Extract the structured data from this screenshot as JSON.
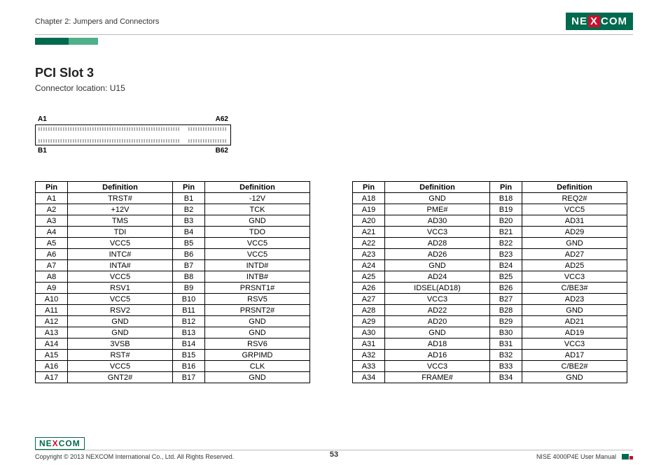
{
  "header": {
    "chapter": "Chapter 2: Jumpers and Connectors",
    "logo_ne": "NE",
    "logo_x": "X",
    "logo_com": "COM"
  },
  "title": "PCI Slot 3",
  "subtitle": "Connector location: U15",
  "conn": {
    "a1": "A1",
    "a62": "A62",
    "b1": "B1",
    "b62": "B62"
  },
  "th": {
    "pin": "Pin",
    "def": "Definition"
  },
  "table1": [
    {
      "ap": "A1",
      "ad": "TRST#",
      "bp": "B1",
      "bd": "-12V"
    },
    {
      "ap": "A2",
      "ad": "+12V",
      "bp": "B2",
      "bd": "TCK"
    },
    {
      "ap": "A3",
      "ad": "TMS",
      "bp": "B3",
      "bd": "GND"
    },
    {
      "ap": "A4",
      "ad": "TDI",
      "bp": "B4",
      "bd": "TDO"
    },
    {
      "ap": "A5",
      "ad": "VCC5",
      "bp": "B5",
      "bd": "VCC5"
    },
    {
      "ap": "A6",
      "ad": "INTC#",
      "bp": "B6",
      "bd": "VCC5"
    },
    {
      "ap": "A7",
      "ad": "INTA#",
      "bp": "B7",
      "bd": "INTD#"
    },
    {
      "ap": "A8",
      "ad": "VCC5",
      "bp": "B8",
      "bd": "INTB#"
    },
    {
      "ap": "A9",
      "ad": "RSV1",
      "bp": "B9",
      "bd": "PRSNT1#"
    },
    {
      "ap": "A10",
      "ad": "VCC5",
      "bp": "B10",
      "bd": "RSV5"
    },
    {
      "ap": "A11",
      "ad": "RSV2",
      "bp": "B11",
      "bd": "PRSNT2#"
    },
    {
      "ap": "A12",
      "ad": "GND",
      "bp": "B12",
      "bd": "GND"
    },
    {
      "ap": "A13",
      "ad": "GND",
      "bp": "B13",
      "bd": "GND"
    },
    {
      "ap": "A14",
      "ad": "3VSB",
      "bp": "B14",
      "bd": "RSV6"
    },
    {
      "ap": "A15",
      "ad": "RST#",
      "bp": "B15",
      "bd": "GRPIMD"
    },
    {
      "ap": "A16",
      "ad": "VCC5",
      "bp": "B16",
      "bd": "CLK"
    },
    {
      "ap": "A17",
      "ad": "GNT2#",
      "bp": "B17",
      "bd": "GND"
    }
  ],
  "table2": [
    {
      "ap": "A18",
      "ad": "GND",
      "bp": "B18",
      "bd": "REQ2#"
    },
    {
      "ap": "A19",
      "ad": "PME#",
      "bp": "B19",
      "bd": "VCC5"
    },
    {
      "ap": "A20",
      "ad": "AD30",
      "bp": "B20",
      "bd": "AD31"
    },
    {
      "ap": "A21",
      "ad": "VCC3",
      "bp": "B21",
      "bd": "AD29"
    },
    {
      "ap": "A22",
      "ad": "AD28",
      "bp": "B22",
      "bd": "GND"
    },
    {
      "ap": "A23",
      "ad": "AD26",
      "bp": "B23",
      "bd": "AD27"
    },
    {
      "ap": "A24",
      "ad": "GND",
      "bp": "B24",
      "bd": "AD25"
    },
    {
      "ap": "A25",
      "ad": "AD24",
      "bp": "B25",
      "bd": "VCC3"
    },
    {
      "ap": "A26",
      "ad": "IDSEL(AD18)",
      "bp": "B26",
      "bd": "C/BE3#"
    },
    {
      "ap": "A27",
      "ad": "VCC3",
      "bp": "B27",
      "bd": "AD23"
    },
    {
      "ap": "A28",
      "ad": "AD22",
      "bp": "B28",
      "bd": "GND"
    },
    {
      "ap": "A29",
      "ad": "AD20",
      "bp": "B29",
      "bd": "AD21"
    },
    {
      "ap": "A30",
      "ad": "GND",
      "bp": "B30",
      "bd": "AD19"
    },
    {
      "ap": "A31",
      "ad": "AD18",
      "bp": "B31",
      "bd": "VCC3"
    },
    {
      "ap": "A32",
      "ad": "AD16",
      "bp": "B32",
      "bd": "AD17"
    },
    {
      "ap": "A33",
      "ad": "VCC3",
      "bp": "B33",
      "bd": "C/BE2#"
    },
    {
      "ap": "A34",
      "ad": "FRAME#",
      "bp": "B34",
      "bd": "GND"
    }
  ],
  "footer": {
    "copyright": "Copyright © 2013 NEXCOM International Co., Ltd. All Rights Reserved.",
    "page": "53",
    "doc": "NISE 4000P4E User Manual"
  }
}
